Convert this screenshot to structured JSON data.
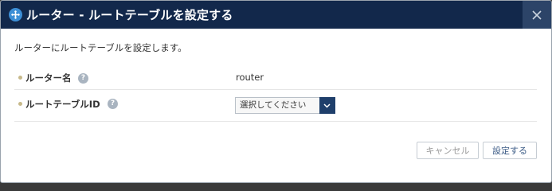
{
  "dialog": {
    "title": "ルーター - ルートテーブルを設定する",
    "description": "ルーターにルートテーブルを設定します。",
    "close_glyph": "✕"
  },
  "form": {
    "fields": [
      {
        "label": "ルーター名",
        "help": "?",
        "value": "router"
      },
      {
        "label": "ルートテーブルID",
        "help": "?",
        "select_value": "選択してください"
      }
    ]
  },
  "buttons": {
    "cancel": "キャンセル",
    "submit": "設定する"
  },
  "colors": {
    "titlebar": "#12284b",
    "accent": "#1f3f6b",
    "title_icon": "#3d8fd6"
  }
}
